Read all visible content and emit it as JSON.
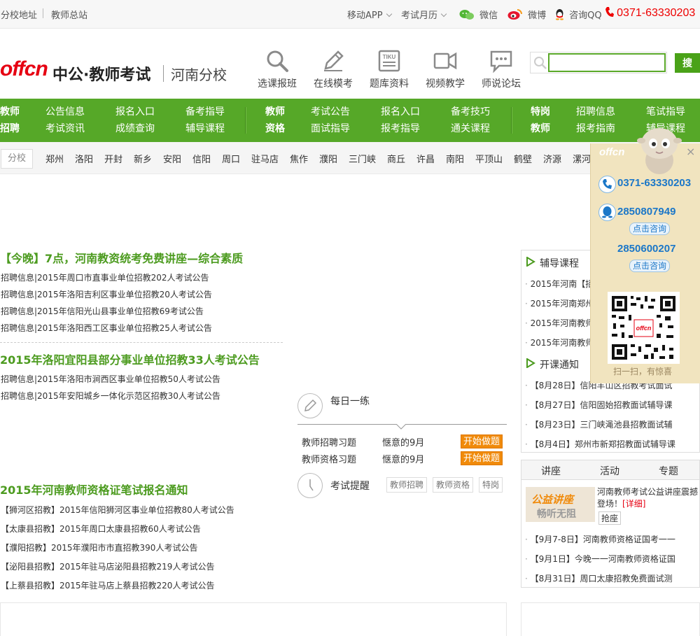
{
  "topbar": {
    "branch_address": "分校地址",
    "teacher_station": "教师总站",
    "mobile_app": "移动APP",
    "exam_calendar": "考试月历",
    "wechat": "微信",
    "weibo": "微博",
    "consult_qq": "咨询QQ",
    "phone": "0371-63330203"
  },
  "header": {
    "logo_offcn": "offcn",
    "logo_text": "中公·教师考试",
    "branch": "河南分校",
    "nav_icons": [
      "选课报班",
      "在线模考",
      "题库资料",
      "视频教学",
      "师说论坛"
    ],
    "tiku_badge": "TIKU",
    "search_placeholder": "",
    "search_button": "搜"
  },
  "green_nav": {
    "sections": [
      {
        "title": [
          "教师",
          "招聘"
        ],
        "items": [
          "公告信息",
          "报名入口",
          "备考指导",
          "考试资讯",
          "成绩查询",
          "辅导课程"
        ]
      },
      {
        "title": [
          "教师",
          "资格"
        ],
        "items": [
          "考试公告",
          "报名入口",
          "备考技巧",
          "面试指导",
          "报考指导",
          "通关课程"
        ]
      },
      {
        "title": [
          "特岗",
          "教师"
        ],
        "items": [
          "招聘信息",
          "笔试指导",
          "报考指南",
          "辅导课程"
        ]
      }
    ]
  },
  "city_bar": {
    "label": "分校",
    "cities": [
      "郑州",
      "洛阳",
      "开封",
      "新乡",
      "安阳",
      "信阳",
      "周口",
      "驻马店",
      "焦作",
      "濮阳",
      "三门峡",
      "商丘",
      "许昌",
      "南阳",
      "平顶山",
      "鹤壁",
      "济源",
      "漯河"
    ]
  },
  "main": {
    "headline1": "【今晚】7点，河南教资统考免费讲座—综合素质",
    "news1": [
      "招聘信息|2015年周口市直事业单位招教202人考试公告",
      "招聘信息|2015年洛阳吉利区事业单位招教20人考试公告",
      "招聘信息|2015年信阳光山县事业单位招教69考试公告",
      "招聘信息|2015年洛阳西工区事业单位招教25人考试公告"
    ],
    "headline2": "2015年洛阳宜阳县部分事业单位招教33人考试公告",
    "news2": [
      "招聘信息|2015年洛阳市涧西区事业单位招教50人考试公告",
      "招聘信息|2015年安阳城乡一体化示范区招教30人考试公告"
    ],
    "headline3": "2015年河南教师资格证笔试报名通知",
    "news3": [
      "【狮河区招教】2015年信阳狮河区事业单位招教80人考试公告",
      "【太康县招教】2015年周口太康县招教60人考试公告",
      "【濮阳招教】2015年濮阳市市直招教390人考试公告",
      "【泌阳县招教】2015年驻马店泌阳县招教219人考试公告",
      "【上蔡县招教】2015年驻马店上蔡县招教220人考试公告"
    ]
  },
  "practice": {
    "title": "每日一练",
    "rows": [
      {
        "label": "教师招聘习题",
        "month": "惬意的9月",
        "button": "开始做题"
      },
      {
        "label": "教师资格习题",
        "month": "惬意的9月",
        "button": "开始做题"
      }
    ],
    "reminder_title": "考试提醒",
    "reminder_tags": [
      "教师招聘",
      "教师资格",
      "特岗"
    ]
  },
  "right": {
    "courses_title": "辅导课程",
    "courses": [
      "2015年河南【招",
      "2015年河南郑州",
      "2015年河南教师",
      "2015年河南教师"
    ],
    "notice_title": "开课通知",
    "notices": [
      "【8月28日】信阳羊山区招教考试面试",
      "【8月27日】信阳固始招教面试辅导课",
      "【8月23日】三门峡渑池县招教面试辅",
      "【8月4日】郑州市新郑招教面试辅导课"
    ],
    "tabs": [
      "讲座",
      "活动",
      "专题"
    ],
    "banner_title": "公益讲座",
    "banner_sub": "畅听无阻",
    "lecture_text": "河南教师考试公益讲座震撼登场！",
    "detail": "[详细]",
    "lecture_tag": "抢座",
    "lectures": [
      "【9月7-8日】河南教师资格证国考一一",
      "【9月1日】今晚一一河南教师资格证国",
      "【8月31日】周口太康招教免费面试测"
    ]
  },
  "float": {
    "logo": "offcn",
    "close": "×",
    "phone": "0371-63330203",
    "qq1": "2850807949",
    "consult1": "点击咨询",
    "qq2": "2850600207",
    "consult2": "点击咨询",
    "scan": "扫一扫，有惊喜"
  },
  "colors": {
    "brand_green": "#56a828",
    "heading_green": "#4c9b1f",
    "brand_red": "#e60012",
    "button_orange": "#f08a0a",
    "float_bg": "#f1e4bf",
    "link_blue": "#1b77c8"
  }
}
